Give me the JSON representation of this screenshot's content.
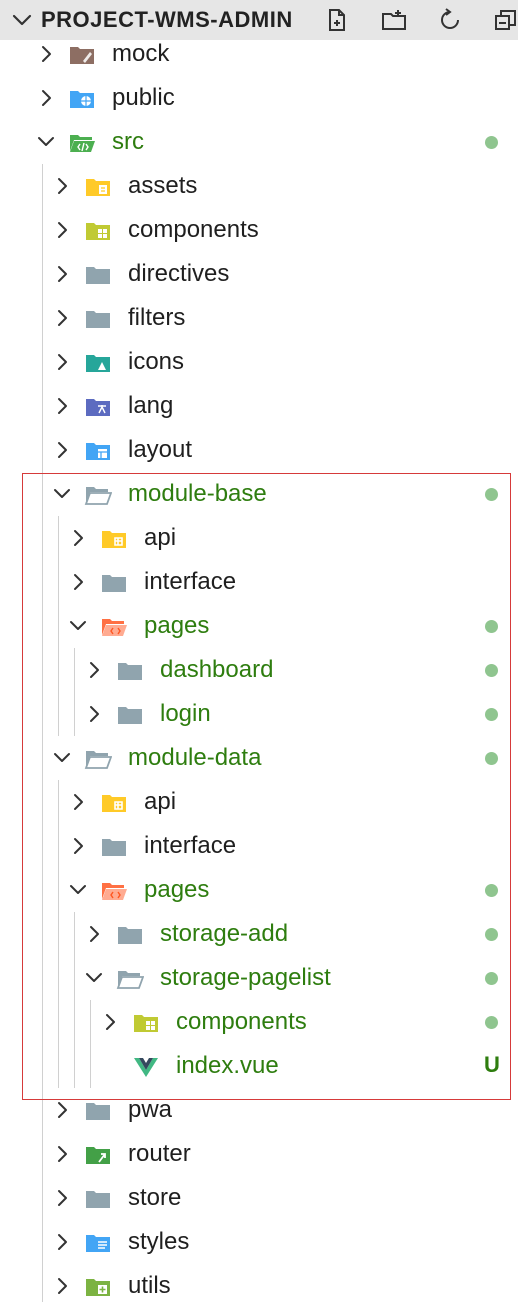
{
  "header": {
    "title": "PROJECT-WMS-ADMIN",
    "buttons": [
      "new-file",
      "new-folder",
      "refresh",
      "collapse-all"
    ]
  },
  "colors": {
    "modified_text": "#2e7d0f",
    "modified_dot": "#8fc58f",
    "highlight_border": "#d63a3a"
  },
  "tree": [
    {
      "label": "mock",
      "depth": 1,
      "expanded": false,
      "icon": "mock-folder-icon",
      "modified": false
    },
    {
      "label": "public",
      "depth": 1,
      "expanded": false,
      "icon": "public-folder-icon",
      "modified": false
    },
    {
      "label": "src",
      "depth": 1,
      "expanded": true,
      "icon": "src-folder-icon",
      "modified": true
    },
    {
      "label": "assets",
      "depth": 2,
      "expanded": false,
      "icon": "assets-folder-icon",
      "modified": false
    },
    {
      "label": "components",
      "depth": 2,
      "expanded": false,
      "icon": "components-folder-icon",
      "modified": false
    },
    {
      "label": "directives",
      "depth": 2,
      "expanded": false,
      "icon": "folder-icon",
      "modified": false
    },
    {
      "label": "filters",
      "depth": 2,
      "expanded": false,
      "icon": "folder-icon",
      "modified": false
    },
    {
      "label": "icons",
      "depth": 2,
      "expanded": false,
      "icon": "icons-folder-icon",
      "modified": false
    },
    {
      "label": "lang",
      "depth": 2,
      "expanded": false,
      "icon": "lang-folder-icon",
      "modified": false
    },
    {
      "label": "layout",
      "depth": 2,
      "expanded": false,
      "icon": "layout-folder-icon",
      "modified": false
    },
    {
      "label": "module-base",
      "depth": 2,
      "expanded": true,
      "icon": "open-folder-icon",
      "modified": true
    },
    {
      "label": "api",
      "depth": 3,
      "expanded": false,
      "icon": "api-folder-icon",
      "modified": false
    },
    {
      "label": "interface",
      "depth": 3,
      "expanded": false,
      "icon": "folder-icon",
      "modified": false
    },
    {
      "label": "pages",
      "depth": 3,
      "expanded": true,
      "icon": "pages-folder-icon",
      "modified": true
    },
    {
      "label": "dashboard",
      "depth": 4,
      "expanded": false,
      "icon": "folder-icon",
      "modified": true
    },
    {
      "label": "login",
      "depth": 4,
      "expanded": false,
      "icon": "folder-icon",
      "modified": true
    },
    {
      "label": "module-data",
      "depth": 2,
      "expanded": true,
      "icon": "open-folder-icon",
      "modified": true
    },
    {
      "label": "api",
      "depth": 3,
      "expanded": false,
      "icon": "api-folder-icon",
      "modified": false
    },
    {
      "label": "interface",
      "depth": 3,
      "expanded": false,
      "icon": "folder-icon",
      "modified": false
    },
    {
      "label": "pages",
      "depth": 3,
      "expanded": true,
      "icon": "pages-folder-icon",
      "modified": true
    },
    {
      "label": "storage-add",
      "depth": 4,
      "expanded": false,
      "icon": "folder-icon",
      "modified": true
    },
    {
      "label": "storage-pagelist",
      "depth": 4,
      "expanded": true,
      "icon": "open-folder-icon",
      "modified": true
    },
    {
      "label": "components",
      "depth": 5,
      "expanded": false,
      "icon": "components-folder-icon",
      "modified": true
    },
    {
      "label": "index.vue",
      "depth": 5,
      "file": true,
      "icon": "vue-file-icon",
      "modified": true,
      "badge": "U"
    },
    {
      "label": "pwa",
      "depth": 2,
      "expanded": false,
      "icon": "folder-icon",
      "modified": false
    },
    {
      "label": "router",
      "depth": 2,
      "expanded": false,
      "icon": "router-folder-icon",
      "modified": false
    },
    {
      "label": "store",
      "depth": 2,
      "expanded": false,
      "icon": "folder-icon",
      "modified": false
    },
    {
      "label": "styles",
      "depth": 2,
      "expanded": false,
      "icon": "styles-folder-icon",
      "modified": false
    },
    {
      "label": "utils",
      "depth": 2,
      "expanded": false,
      "icon": "utils-folder-icon",
      "modified": false
    }
  ]
}
